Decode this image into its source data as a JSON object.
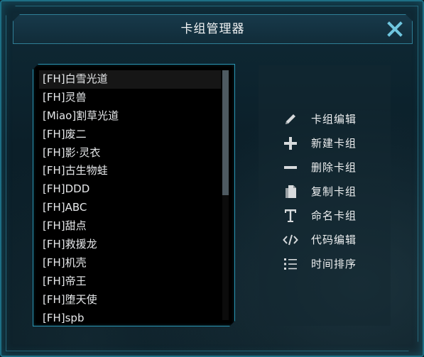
{
  "window": {
    "title": "卡组管理器"
  },
  "deck_list": {
    "items": [
      "[FH]白雪光道",
      "[FH]灵兽",
      "[Miao]割草光道",
      "[FH]废二",
      "[FH]影·灵衣",
      "[FH]古生物蛙",
      "[FH]DDD",
      "[FH]ABC",
      "[FH]甜点",
      "[FH]救援龙",
      "[FH]机壳",
      "[FH]帝王",
      "[FH]堕天使",
      "[FH]spb"
    ],
    "selected_index": 0
  },
  "actions": [
    {
      "label": "卡组编辑",
      "icon": "pencil-icon"
    },
    {
      "label": "新建卡组",
      "icon": "plus-icon"
    },
    {
      "label": "删除卡组",
      "icon": "minus-icon"
    },
    {
      "label": "复制卡组",
      "icon": "copy-icon"
    },
    {
      "label": "命名卡组",
      "icon": "text-icon"
    },
    {
      "label": "代码编辑",
      "icon": "code-icon"
    },
    {
      "label": "时间排序",
      "icon": "list-icon"
    }
  ],
  "colors": {
    "accent": "#2a93b1",
    "close": "#6fc6df"
  }
}
